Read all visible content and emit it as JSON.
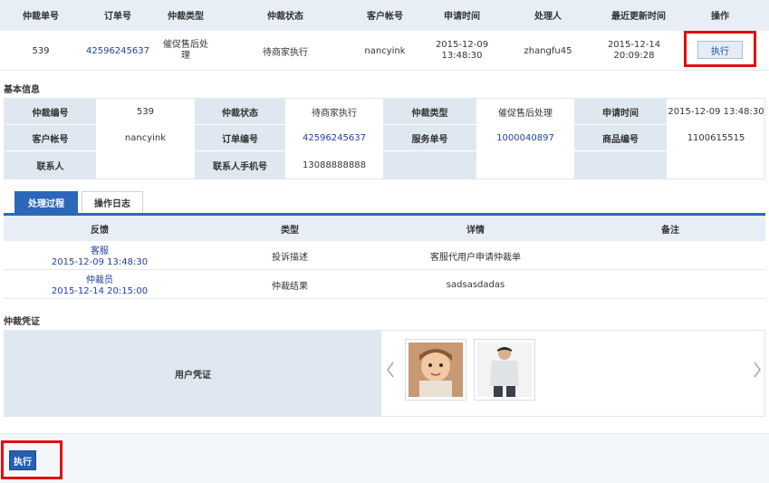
{
  "top_table": {
    "headers": [
      "仲裁单号",
      "订单号",
      "仲裁类型",
      "仲裁状态",
      "客户帐号",
      "申请时间",
      "处理人",
      "最近更新时间",
      "操作"
    ],
    "row": {
      "id": "539",
      "order_no": "42596245637",
      "type": "催促售后处理",
      "status": "待商家执行",
      "account": "nancyink",
      "apply_time": "2015-12-09 13:48:30",
      "handler": "zhangfu45",
      "update_time": "2015-12-14 20:09:28",
      "action": "执行"
    }
  },
  "basic_info": {
    "section_title": "基本信息",
    "row1": [
      {
        "label": "仲裁编号",
        "value": "539"
      },
      {
        "label": "仲裁状态",
        "value": "待商家执行"
      },
      {
        "label": "仲裁类型",
        "value": "催促售后处理"
      },
      {
        "label": "申请时间",
        "value": "2015-12-09 13:48:30"
      }
    ],
    "row2": [
      {
        "label": "客户帐号",
        "value": "nancyink"
      },
      {
        "label": "订单编号",
        "value": "42596245637"
      },
      {
        "label": "服务单号",
        "value": "1000040897"
      },
      {
        "label": "商品编号",
        "value": "1100615515"
      }
    ],
    "row3": [
      {
        "label": "联系人",
        "value": ""
      },
      {
        "label": "联系人手机号",
        "value": "13088888888"
      }
    ]
  },
  "tabs": {
    "process": "处理过程",
    "log": "操作日志"
  },
  "process_table": {
    "headers": [
      "反馈",
      "类型",
      "详情",
      "备注"
    ],
    "rows": [
      {
        "who": "客服",
        "time": "2015-12-09 13:48:30",
        "type": "投诉描述",
        "detail": "客服代用户申请仲裁单",
        "note": ""
      },
      {
        "who": "仲裁员",
        "time": "2015-12-14 20:15:00",
        "type": "仲裁结果",
        "detail": "sadsasdadas",
        "note": ""
      }
    ]
  },
  "evidence": {
    "section_title": "仲裁凭证",
    "label": "用户凭证",
    "prev_icon": "chevron-left-icon",
    "next_icon": "chevron-right-icon",
    "thumbnails": [
      "child-photo",
      "man-shirt-photo"
    ]
  },
  "footer": {
    "execute_button": "执行"
  },
  "colors": {
    "highlight_red": "#e10f0f",
    "header_bg": "#e7eef6",
    "label_bg": "#dfe8f1",
    "link_blue": "#1f3fa5",
    "button_blue": "#245fb3"
  }
}
